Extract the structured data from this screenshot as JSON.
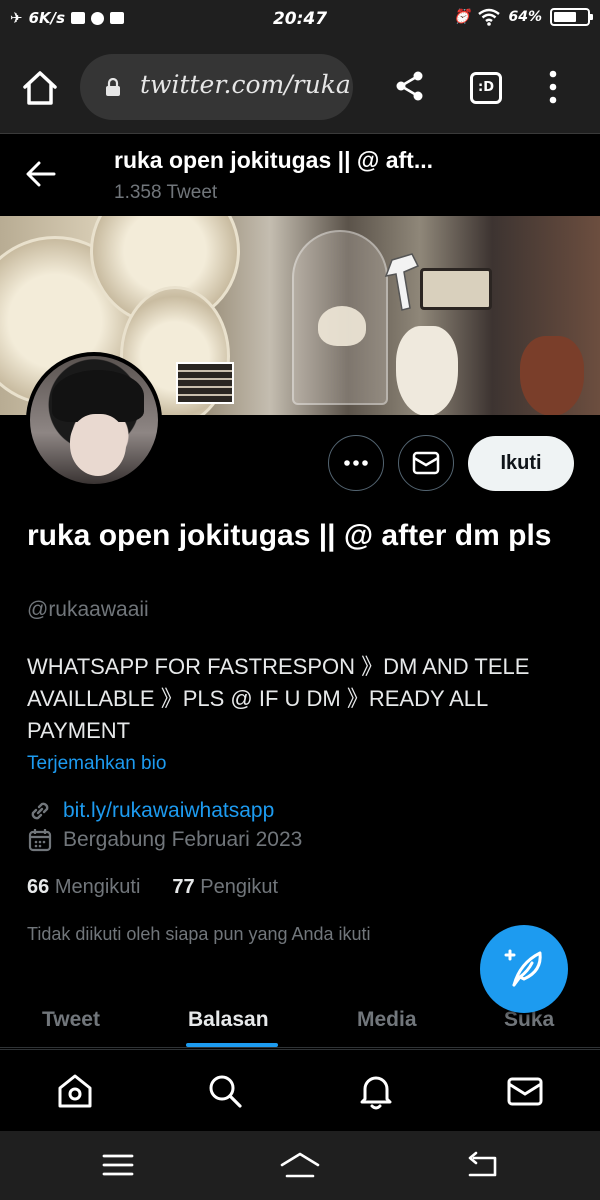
{
  "status_bar": {
    "net_speed": "6K/s",
    "time": "20:47",
    "battery": "64%"
  },
  "browser": {
    "url": "twitter.com/ruka",
    "tabs_label": ":D"
  },
  "header": {
    "name": "ruka open jokitugas || @ aft...",
    "tweet_count": "1.358 Tweet"
  },
  "profile": {
    "name": "ruka open jokitugas || @ after dm pls",
    "handle": "@rukaawaaii",
    "bio": "WHATSAPP FOR FASTRESPON 》DM AND TELE AVAILLABLE 》PLS @ IF U DM 》READY ALL PAYMENT",
    "translate": "Terjemahkan bio",
    "link": "bit.ly/rukawaiwhatsapp",
    "joined": "Bergabung Februari 2023",
    "following_count": "66",
    "following_label": "Mengikuti",
    "followers_count": "77",
    "followers_label": "Pengikut",
    "not_followed": "Tidak diikuti oleh siapa pun yang Anda ikuti"
  },
  "actions": {
    "follow_label": "Ikuti",
    "more_icon": "more-icon",
    "message_icon": "mail-icon"
  },
  "tabs": [
    {
      "label": "Tweet"
    },
    {
      "label": "Balasan"
    },
    {
      "label": "Media"
    },
    {
      "label": "Suka"
    }
  ],
  "active_tab": "Balasan",
  "bottom_nav": [
    "home-icon",
    "search-icon",
    "notifications-icon",
    "messages-icon"
  ],
  "colors": {
    "accent": "#1d9bf0",
    "background": "#000000",
    "secondary_text": "#71767b",
    "follow_button_bg": "#eff3f4"
  }
}
